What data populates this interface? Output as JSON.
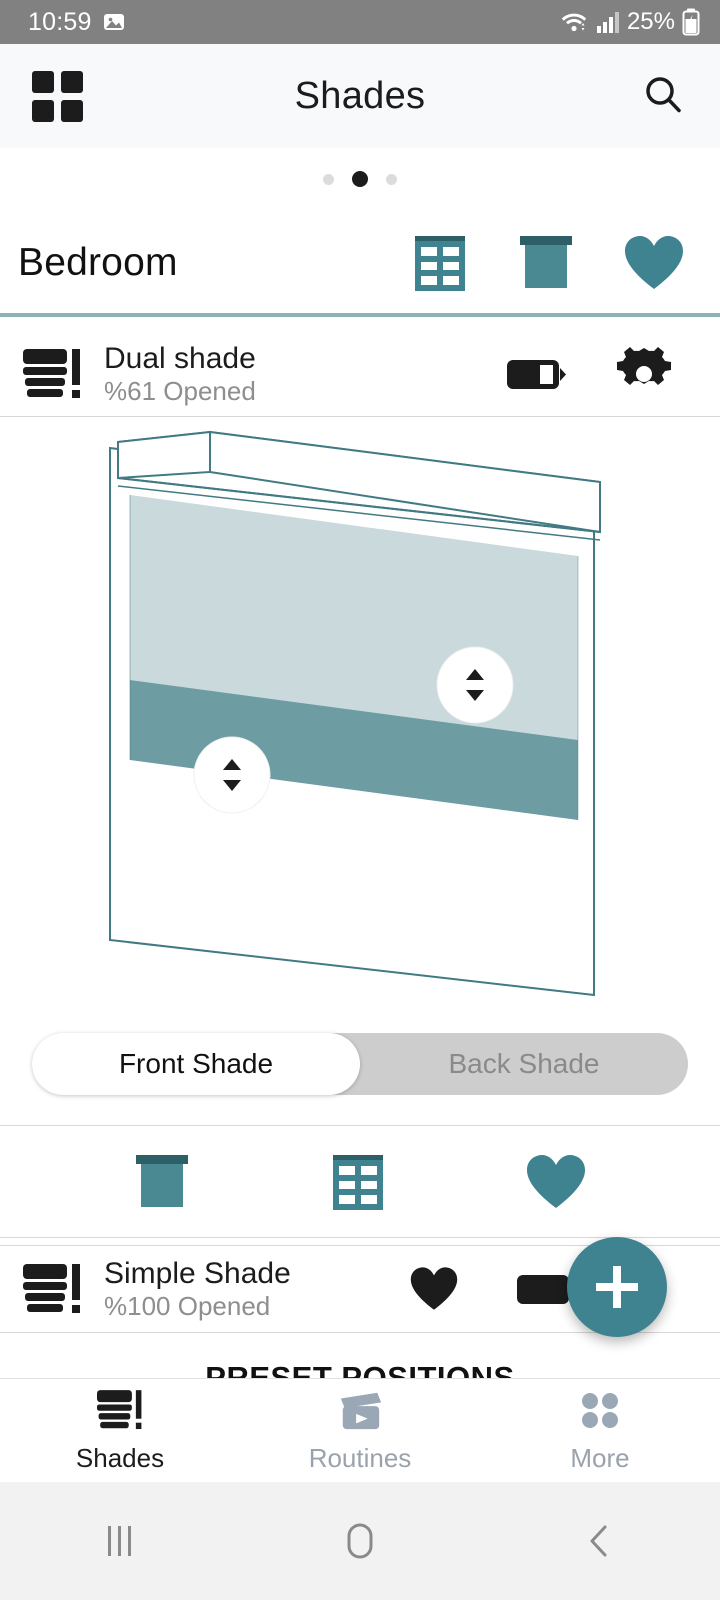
{
  "status_bar": {
    "time": "10:59",
    "battery_percent": "25%",
    "icons": [
      "image-icon",
      "wifi-icon",
      "signal-icon",
      "battery-charging-icon"
    ]
  },
  "app_bar": {
    "title": "Shades",
    "left_icon": "grid-menu-icon",
    "right_icon": "search-icon"
  },
  "pager": {
    "dots": 3,
    "active_index": 1
  },
  "room": {
    "name": "Bedroom",
    "actions": [
      {
        "name": "open-window-icon",
        "label": "Open"
      },
      {
        "name": "close-shade-icon",
        "label": "Close"
      },
      {
        "name": "favorite-heart-icon",
        "label": "Favorite"
      }
    ]
  },
  "devices": [
    {
      "title": "Dual shade",
      "status": "%61 Opened",
      "icon": "shade-alert-icon",
      "battery": "battery-half-icon",
      "settings": "gear-icon"
    },
    {
      "title": "Simple Shade",
      "status": "%100 Opened",
      "icon": "shade-alert-icon",
      "favorite": "heart-icon",
      "battery": "battery-full-icon"
    }
  ],
  "shade_view": {
    "front_open_percent": 61,
    "handles": [
      {
        "name": "front-shade-handle"
      },
      {
        "name": "back-shade-handle"
      }
    ],
    "colors": {
      "outline": "#417a82",
      "upper_panel": "#c9d9dc",
      "lower_panel": "#6d9ca3"
    }
  },
  "segment": {
    "options": [
      "Front Shade",
      "Back Shade"
    ],
    "selected": "Front Shade"
  },
  "quick_actions": [
    {
      "name": "close-shade-icon"
    },
    {
      "name": "open-window-icon"
    },
    {
      "name": "favorite-heart-icon"
    }
  ],
  "preset_section": {
    "title": "PRESET POSITIONS"
  },
  "fab": {
    "label": "+",
    "name": "add-button",
    "color": "#3f8390"
  },
  "bottom_nav": {
    "items": [
      {
        "label": "Shades",
        "icon": "shades-icon",
        "active": true
      },
      {
        "label": "Routines",
        "icon": "routines-icon",
        "active": false
      },
      {
        "label": "More",
        "icon": "more-dots-icon",
        "active": false
      }
    ]
  },
  "system_nav": {
    "recents": "recents-icon",
    "home": "home-icon",
    "back": "back-icon"
  },
  "theme": {
    "accent": "#3f8390",
    "accent_dark": "#2d5f66",
    "status_bar_bg": "#818181",
    "app_bar_bg": "#f7f9fa"
  }
}
